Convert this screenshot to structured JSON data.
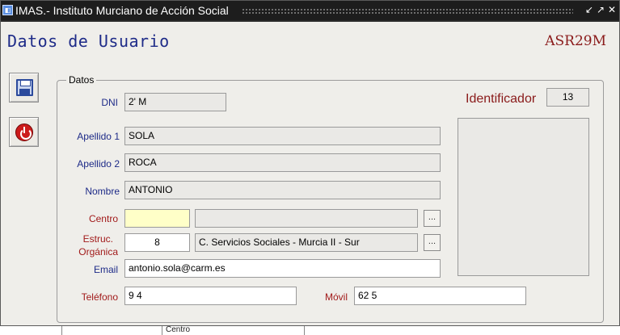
{
  "window": {
    "title": "IMAS.- Instituto Murciano de Acción Social",
    "controls": [
      "↙",
      "↗",
      "✕"
    ]
  },
  "header": {
    "form_title": "Datos de Usuario",
    "form_code": "ASR29M"
  },
  "toolbar": {
    "save_icon": "save-icon",
    "exit_icon": "power-icon"
  },
  "group": {
    "legend": "Datos"
  },
  "fields": {
    "dni": {
      "label": "DNI",
      "value": "2' M"
    },
    "identificador": {
      "label": "Identificador",
      "value": "13"
    },
    "apellido1": {
      "label": "Apellido 1",
      "value": "SOLA"
    },
    "apellido2": {
      "label": "Apellido 2",
      "value": "ROCA"
    },
    "nombre": {
      "label": "Nombre",
      "value": "ANTONIO"
    },
    "centro": {
      "label": "Centro",
      "code": "",
      "description": "",
      "lookup": "..."
    },
    "estructura": {
      "label_line1": "Estruc.",
      "label_line2": "Orgánica",
      "code": "8",
      "description": "C. Servicios Sociales - Murcia II - Sur",
      "lookup": "..."
    },
    "email": {
      "label": "Email",
      "value": "antonio.sola@carm.es"
    },
    "telefono": {
      "label": "Teléfono",
      "value": "9 4"
    },
    "movil": {
      "label": "Móvil",
      "value": "62 5"
    }
  },
  "under_window": {
    "text": "Centro"
  },
  "colors": {
    "title_blue": "#1e2b88",
    "label_red": "#a11a1a",
    "required_yellow": "#ffffc8"
  }
}
